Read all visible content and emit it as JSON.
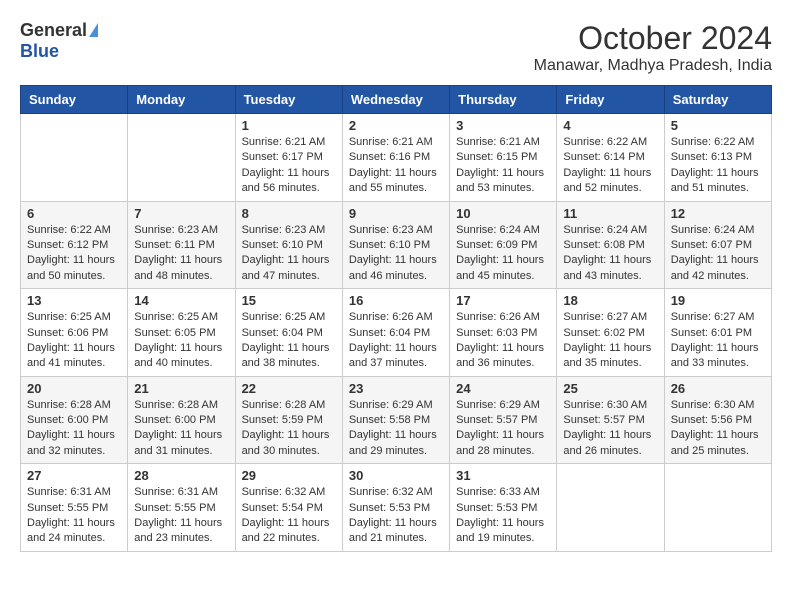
{
  "logo": {
    "general": "General",
    "blue": "Blue"
  },
  "title": "October 2024",
  "location": "Manawar, Madhya Pradesh, India",
  "days_header": [
    "Sunday",
    "Monday",
    "Tuesday",
    "Wednesday",
    "Thursday",
    "Friday",
    "Saturday"
  ],
  "weeks": [
    [
      {
        "day": "",
        "sunrise": "",
        "sunset": "",
        "daylight": ""
      },
      {
        "day": "",
        "sunrise": "",
        "sunset": "",
        "daylight": ""
      },
      {
        "day": "1",
        "sunrise": "Sunrise: 6:21 AM",
        "sunset": "Sunset: 6:17 PM",
        "daylight": "Daylight: 11 hours and 56 minutes."
      },
      {
        "day": "2",
        "sunrise": "Sunrise: 6:21 AM",
        "sunset": "Sunset: 6:16 PM",
        "daylight": "Daylight: 11 hours and 55 minutes."
      },
      {
        "day": "3",
        "sunrise": "Sunrise: 6:21 AM",
        "sunset": "Sunset: 6:15 PM",
        "daylight": "Daylight: 11 hours and 53 minutes."
      },
      {
        "day": "4",
        "sunrise": "Sunrise: 6:22 AM",
        "sunset": "Sunset: 6:14 PM",
        "daylight": "Daylight: 11 hours and 52 minutes."
      },
      {
        "day": "5",
        "sunrise": "Sunrise: 6:22 AM",
        "sunset": "Sunset: 6:13 PM",
        "daylight": "Daylight: 11 hours and 51 minutes."
      }
    ],
    [
      {
        "day": "6",
        "sunrise": "Sunrise: 6:22 AM",
        "sunset": "Sunset: 6:12 PM",
        "daylight": "Daylight: 11 hours and 50 minutes."
      },
      {
        "day": "7",
        "sunrise": "Sunrise: 6:23 AM",
        "sunset": "Sunset: 6:11 PM",
        "daylight": "Daylight: 11 hours and 48 minutes."
      },
      {
        "day": "8",
        "sunrise": "Sunrise: 6:23 AM",
        "sunset": "Sunset: 6:10 PM",
        "daylight": "Daylight: 11 hours and 47 minutes."
      },
      {
        "day": "9",
        "sunrise": "Sunrise: 6:23 AM",
        "sunset": "Sunset: 6:10 PM",
        "daylight": "Daylight: 11 hours and 46 minutes."
      },
      {
        "day": "10",
        "sunrise": "Sunrise: 6:24 AM",
        "sunset": "Sunset: 6:09 PM",
        "daylight": "Daylight: 11 hours and 45 minutes."
      },
      {
        "day": "11",
        "sunrise": "Sunrise: 6:24 AM",
        "sunset": "Sunset: 6:08 PM",
        "daylight": "Daylight: 11 hours and 43 minutes."
      },
      {
        "day": "12",
        "sunrise": "Sunrise: 6:24 AM",
        "sunset": "Sunset: 6:07 PM",
        "daylight": "Daylight: 11 hours and 42 minutes."
      }
    ],
    [
      {
        "day": "13",
        "sunrise": "Sunrise: 6:25 AM",
        "sunset": "Sunset: 6:06 PM",
        "daylight": "Daylight: 11 hours and 41 minutes."
      },
      {
        "day": "14",
        "sunrise": "Sunrise: 6:25 AM",
        "sunset": "Sunset: 6:05 PM",
        "daylight": "Daylight: 11 hours and 40 minutes."
      },
      {
        "day": "15",
        "sunrise": "Sunrise: 6:25 AM",
        "sunset": "Sunset: 6:04 PM",
        "daylight": "Daylight: 11 hours and 38 minutes."
      },
      {
        "day": "16",
        "sunrise": "Sunrise: 6:26 AM",
        "sunset": "Sunset: 6:04 PM",
        "daylight": "Daylight: 11 hours and 37 minutes."
      },
      {
        "day": "17",
        "sunrise": "Sunrise: 6:26 AM",
        "sunset": "Sunset: 6:03 PM",
        "daylight": "Daylight: 11 hours and 36 minutes."
      },
      {
        "day": "18",
        "sunrise": "Sunrise: 6:27 AM",
        "sunset": "Sunset: 6:02 PM",
        "daylight": "Daylight: 11 hours and 35 minutes."
      },
      {
        "day": "19",
        "sunrise": "Sunrise: 6:27 AM",
        "sunset": "Sunset: 6:01 PM",
        "daylight": "Daylight: 11 hours and 33 minutes."
      }
    ],
    [
      {
        "day": "20",
        "sunrise": "Sunrise: 6:28 AM",
        "sunset": "Sunset: 6:00 PM",
        "daylight": "Daylight: 11 hours and 32 minutes."
      },
      {
        "day": "21",
        "sunrise": "Sunrise: 6:28 AM",
        "sunset": "Sunset: 6:00 PM",
        "daylight": "Daylight: 11 hours and 31 minutes."
      },
      {
        "day": "22",
        "sunrise": "Sunrise: 6:28 AM",
        "sunset": "Sunset: 5:59 PM",
        "daylight": "Daylight: 11 hours and 30 minutes."
      },
      {
        "day": "23",
        "sunrise": "Sunrise: 6:29 AM",
        "sunset": "Sunset: 5:58 PM",
        "daylight": "Daylight: 11 hours and 29 minutes."
      },
      {
        "day": "24",
        "sunrise": "Sunrise: 6:29 AM",
        "sunset": "Sunset: 5:57 PM",
        "daylight": "Daylight: 11 hours and 28 minutes."
      },
      {
        "day": "25",
        "sunrise": "Sunrise: 6:30 AM",
        "sunset": "Sunset: 5:57 PM",
        "daylight": "Daylight: 11 hours and 26 minutes."
      },
      {
        "day": "26",
        "sunrise": "Sunrise: 6:30 AM",
        "sunset": "Sunset: 5:56 PM",
        "daylight": "Daylight: 11 hours and 25 minutes."
      }
    ],
    [
      {
        "day": "27",
        "sunrise": "Sunrise: 6:31 AM",
        "sunset": "Sunset: 5:55 PM",
        "daylight": "Daylight: 11 hours and 24 minutes."
      },
      {
        "day": "28",
        "sunrise": "Sunrise: 6:31 AM",
        "sunset": "Sunset: 5:55 PM",
        "daylight": "Daylight: 11 hours and 23 minutes."
      },
      {
        "day": "29",
        "sunrise": "Sunrise: 6:32 AM",
        "sunset": "Sunset: 5:54 PM",
        "daylight": "Daylight: 11 hours and 22 minutes."
      },
      {
        "day": "30",
        "sunrise": "Sunrise: 6:32 AM",
        "sunset": "Sunset: 5:53 PM",
        "daylight": "Daylight: 11 hours and 21 minutes."
      },
      {
        "day": "31",
        "sunrise": "Sunrise: 6:33 AM",
        "sunset": "Sunset: 5:53 PM",
        "daylight": "Daylight: 11 hours and 19 minutes."
      },
      {
        "day": "",
        "sunrise": "",
        "sunset": "",
        "daylight": ""
      },
      {
        "day": "",
        "sunrise": "",
        "sunset": "",
        "daylight": ""
      }
    ]
  ]
}
